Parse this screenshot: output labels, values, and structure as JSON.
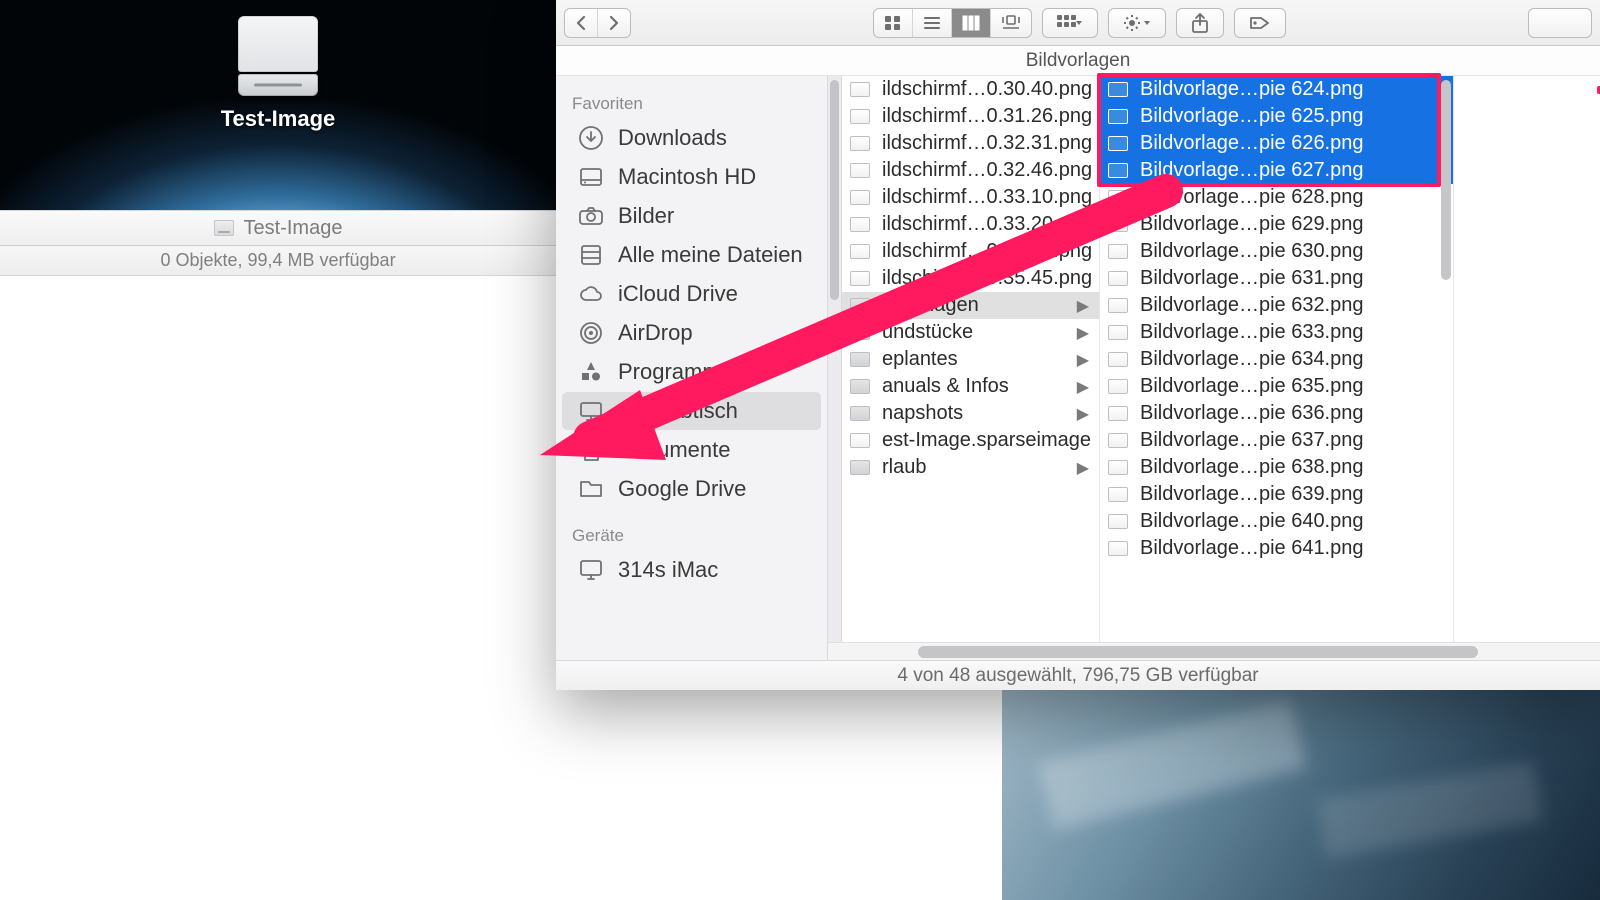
{
  "desktop": {
    "drive_label": "Test-Image"
  },
  "mini_window": {
    "title": "Test-Image",
    "status": "0 Objekte, 99,4 MB verfügbar"
  },
  "finder": {
    "title": "Bildvorlagen",
    "status": "4 von 48 ausgewählt, 796,75 GB verfügbar",
    "sidebar": {
      "section1": "Favoriten",
      "items1": [
        {
          "icon": "downloads",
          "label": "Downloads"
        },
        {
          "icon": "hdd",
          "label": "Macintosh HD"
        },
        {
          "icon": "camera",
          "label": "Bilder"
        },
        {
          "icon": "allfiles",
          "label": "Alle meine Dateien"
        },
        {
          "icon": "cloud",
          "label": "iCloud Drive"
        },
        {
          "icon": "airdrop",
          "label": "AirDrop"
        },
        {
          "icon": "apps",
          "label": "Programme"
        },
        {
          "icon": "desktop",
          "label": "Schreibtisch",
          "selected": true
        },
        {
          "icon": "docs",
          "label": "Dokumente"
        },
        {
          "icon": "folder",
          "label": "Google Drive"
        }
      ],
      "section2": "Geräte",
      "items2": [
        {
          "icon": "imac",
          "label": "314s iMac"
        }
      ]
    },
    "col1": [
      {
        "t": "file",
        "label": "ildschirmf…0.30.40.png"
      },
      {
        "t": "file",
        "label": "ildschirmf…0.31.26.png"
      },
      {
        "t": "file",
        "label": "ildschirmf…0.32.31.png"
      },
      {
        "t": "file",
        "label": "ildschirmf…0.32.46.png"
      },
      {
        "t": "file",
        "label": "ildschirmf…0.33.10.png"
      },
      {
        "t": "file",
        "label": "ildschirmf…0.33.20.png"
      },
      {
        "t": "file",
        "label": "ildschirmf…0.34.41.png"
      },
      {
        "t": "file",
        "label": "ildschirmf…0.35.45.png"
      },
      {
        "t": "folder",
        "label": "ildvorlagen",
        "selected": true
      },
      {
        "t": "folder",
        "label": "undstücke"
      },
      {
        "t": "folder",
        "label": "eplantes"
      },
      {
        "t": "folder",
        "label": "anuals & Infos"
      },
      {
        "t": "folder",
        "label": "napshots"
      },
      {
        "t": "file",
        "label": "est-Image.sparseimage"
      },
      {
        "t": "folder",
        "label": "rlaub"
      }
    ],
    "col2": [
      {
        "label": "Bildvorlage…pie 624.png",
        "hl": true
      },
      {
        "label": "Bildvorlage…pie 625.png",
        "hl": true
      },
      {
        "label": "Bildvorlage…pie 626.png",
        "hl": true
      },
      {
        "label": "Bildvorlage…pie 627.png",
        "hl": true
      },
      {
        "label": "Bildvorlage…pie 628.png"
      },
      {
        "label": "Bildvorlage…pie 629.png"
      },
      {
        "label": "Bildvorlage…pie 630.png"
      },
      {
        "label": "Bildvorlage…pie 631.png"
      },
      {
        "label": "Bildvorlage…pie 632.png"
      },
      {
        "label": "Bildvorlage…pie 633.png"
      },
      {
        "label": "Bildvorlage…pie 634.png"
      },
      {
        "label": "Bildvorlage…pie 635.png"
      },
      {
        "label": "Bildvorlage…pie 636.png"
      },
      {
        "label": "Bildvorlage…pie 637.png"
      },
      {
        "label": "Bildvorlage…pie 638.png"
      },
      {
        "label": "Bildvorlage…pie 639.png"
      },
      {
        "label": "Bildvorlage…pie 640.png"
      },
      {
        "label": "Bildvorlage…pie 641.png"
      }
    ]
  }
}
